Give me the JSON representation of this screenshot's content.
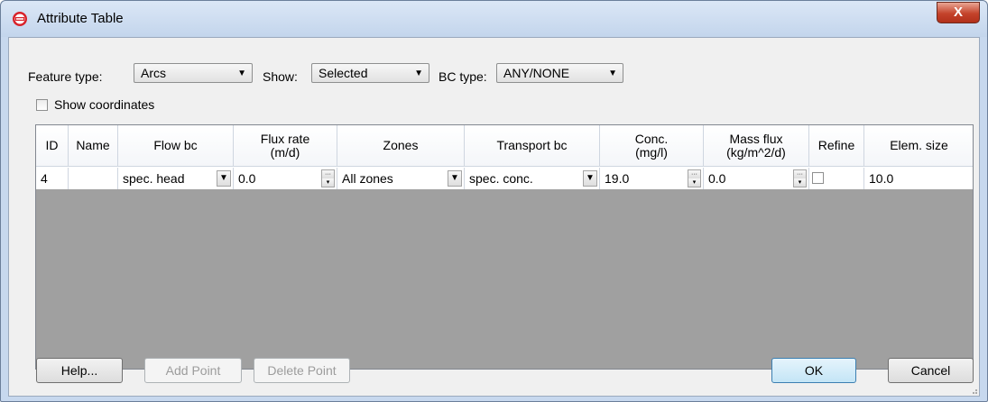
{
  "window": {
    "title": "Attribute Table",
    "close_glyph": "X"
  },
  "filters": {
    "feature_type_label": "Feature type:",
    "feature_type_value": "Arcs",
    "show_label": "Show:",
    "show_value": "Selected",
    "bc_type_label": "BC type:",
    "bc_type_value": "ANY/NONE",
    "show_coordinates_label": "Show coordinates",
    "show_coordinates_checked": false
  },
  "table": {
    "headers": {
      "id": "ID",
      "name": "Name",
      "flow_bc": "Flow bc",
      "flux_rate_1": "Flux rate",
      "flux_rate_2": "(m/d)",
      "zones": "Zones",
      "transport_bc": "Transport bc",
      "conc_1": "Conc.",
      "conc_2": "(mg/l)",
      "mass_flux_1": "Mass flux",
      "mass_flux_2": "(kg/m^2/d)",
      "refine": "Refine",
      "elem_size": "Elem. size"
    },
    "rows": [
      {
        "id": "4",
        "name": "",
        "flow_bc": "spec. head",
        "flux_rate": "0.0",
        "zones": "All zones",
        "transport_bc": "spec. conc.",
        "conc": "19.0",
        "mass_flux": "0.0",
        "refine": false,
        "elem_size": "10.0"
      }
    ]
  },
  "buttons": {
    "help": "Help...",
    "add_point": "Add Point",
    "delete_point": "Delete Point",
    "ok": "OK",
    "cancel": "Cancel"
  },
  "colors": {
    "title_bar": "#c3d5ec",
    "close_button": "#c4432b",
    "grid_background": "#a0a0a0",
    "dialog_background": "#f0f0f0"
  },
  "icons": [
    "app-logo-icon",
    "close-icon",
    "dropdown-arrow-icon",
    "spinner-icon",
    "resize-grip-icon"
  ]
}
